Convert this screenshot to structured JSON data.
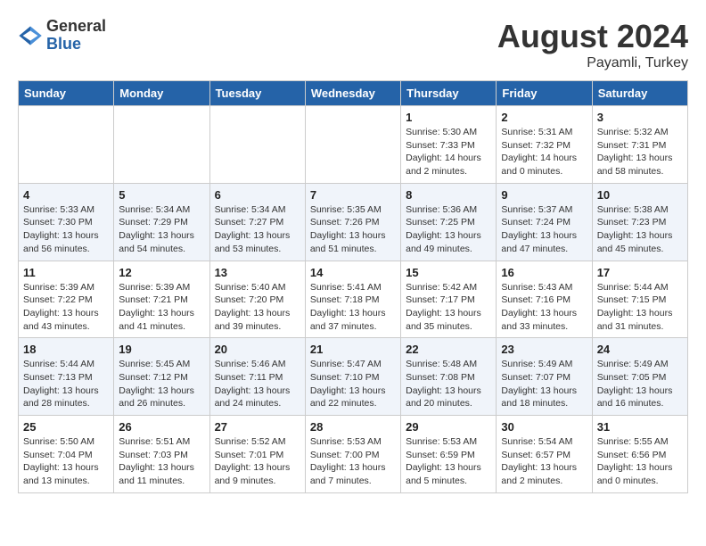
{
  "logo": {
    "general": "General",
    "blue": "Blue"
  },
  "title": {
    "month_year": "August 2024",
    "location": "Payamli, Turkey"
  },
  "weekdays": [
    "Sunday",
    "Monday",
    "Tuesday",
    "Wednesday",
    "Thursday",
    "Friday",
    "Saturday"
  ],
  "weeks": [
    [
      {
        "day": "",
        "info": ""
      },
      {
        "day": "",
        "info": ""
      },
      {
        "day": "",
        "info": ""
      },
      {
        "day": "",
        "info": ""
      },
      {
        "day": "1",
        "info": "Sunrise: 5:30 AM\nSunset: 7:33 PM\nDaylight: 14 hours\nand 2 minutes."
      },
      {
        "day": "2",
        "info": "Sunrise: 5:31 AM\nSunset: 7:32 PM\nDaylight: 14 hours\nand 0 minutes."
      },
      {
        "day": "3",
        "info": "Sunrise: 5:32 AM\nSunset: 7:31 PM\nDaylight: 13 hours\nand 58 minutes."
      }
    ],
    [
      {
        "day": "4",
        "info": "Sunrise: 5:33 AM\nSunset: 7:30 PM\nDaylight: 13 hours\nand 56 minutes."
      },
      {
        "day": "5",
        "info": "Sunrise: 5:34 AM\nSunset: 7:29 PM\nDaylight: 13 hours\nand 54 minutes."
      },
      {
        "day": "6",
        "info": "Sunrise: 5:34 AM\nSunset: 7:27 PM\nDaylight: 13 hours\nand 53 minutes."
      },
      {
        "day": "7",
        "info": "Sunrise: 5:35 AM\nSunset: 7:26 PM\nDaylight: 13 hours\nand 51 minutes."
      },
      {
        "day": "8",
        "info": "Sunrise: 5:36 AM\nSunset: 7:25 PM\nDaylight: 13 hours\nand 49 minutes."
      },
      {
        "day": "9",
        "info": "Sunrise: 5:37 AM\nSunset: 7:24 PM\nDaylight: 13 hours\nand 47 minutes."
      },
      {
        "day": "10",
        "info": "Sunrise: 5:38 AM\nSunset: 7:23 PM\nDaylight: 13 hours\nand 45 minutes."
      }
    ],
    [
      {
        "day": "11",
        "info": "Sunrise: 5:39 AM\nSunset: 7:22 PM\nDaylight: 13 hours\nand 43 minutes."
      },
      {
        "day": "12",
        "info": "Sunrise: 5:39 AM\nSunset: 7:21 PM\nDaylight: 13 hours\nand 41 minutes."
      },
      {
        "day": "13",
        "info": "Sunrise: 5:40 AM\nSunset: 7:20 PM\nDaylight: 13 hours\nand 39 minutes."
      },
      {
        "day": "14",
        "info": "Sunrise: 5:41 AM\nSunset: 7:18 PM\nDaylight: 13 hours\nand 37 minutes."
      },
      {
        "day": "15",
        "info": "Sunrise: 5:42 AM\nSunset: 7:17 PM\nDaylight: 13 hours\nand 35 minutes."
      },
      {
        "day": "16",
        "info": "Sunrise: 5:43 AM\nSunset: 7:16 PM\nDaylight: 13 hours\nand 33 minutes."
      },
      {
        "day": "17",
        "info": "Sunrise: 5:44 AM\nSunset: 7:15 PM\nDaylight: 13 hours\nand 31 minutes."
      }
    ],
    [
      {
        "day": "18",
        "info": "Sunrise: 5:44 AM\nSunset: 7:13 PM\nDaylight: 13 hours\nand 28 minutes."
      },
      {
        "day": "19",
        "info": "Sunrise: 5:45 AM\nSunset: 7:12 PM\nDaylight: 13 hours\nand 26 minutes."
      },
      {
        "day": "20",
        "info": "Sunrise: 5:46 AM\nSunset: 7:11 PM\nDaylight: 13 hours\nand 24 minutes."
      },
      {
        "day": "21",
        "info": "Sunrise: 5:47 AM\nSunset: 7:10 PM\nDaylight: 13 hours\nand 22 minutes."
      },
      {
        "day": "22",
        "info": "Sunrise: 5:48 AM\nSunset: 7:08 PM\nDaylight: 13 hours\nand 20 minutes."
      },
      {
        "day": "23",
        "info": "Sunrise: 5:49 AM\nSunset: 7:07 PM\nDaylight: 13 hours\nand 18 minutes."
      },
      {
        "day": "24",
        "info": "Sunrise: 5:49 AM\nSunset: 7:05 PM\nDaylight: 13 hours\nand 16 minutes."
      }
    ],
    [
      {
        "day": "25",
        "info": "Sunrise: 5:50 AM\nSunset: 7:04 PM\nDaylight: 13 hours\nand 13 minutes."
      },
      {
        "day": "26",
        "info": "Sunrise: 5:51 AM\nSunset: 7:03 PM\nDaylight: 13 hours\nand 11 minutes."
      },
      {
        "day": "27",
        "info": "Sunrise: 5:52 AM\nSunset: 7:01 PM\nDaylight: 13 hours\nand 9 minutes."
      },
      {
        "day": "28",
        "info": "Sunrise: 5:53 AM\nSunset: 7:00 PM\nDaylight: 13 hours\nand 7 minutes."
      },
      {
        "day": "29",
        "info": "Sunrise: 5:53 AM\nSunset: 6:59 PM\nDaylight: 13 hours\nand 5 minutes."
      },
      {
        "day": "30",
        "info": "Sunrise: 5:54 AM\nSunset: 6:57 PM\nDaylight: 13 hours\nand 2 minutes."
      },
      {
        "day": "31",
        "info": "Sunrise: 5:55 AM\nSunset: 6:56 PM\nDaylight: 13 hours\nand 0 minutes."
      }
    ]
  ]
}
